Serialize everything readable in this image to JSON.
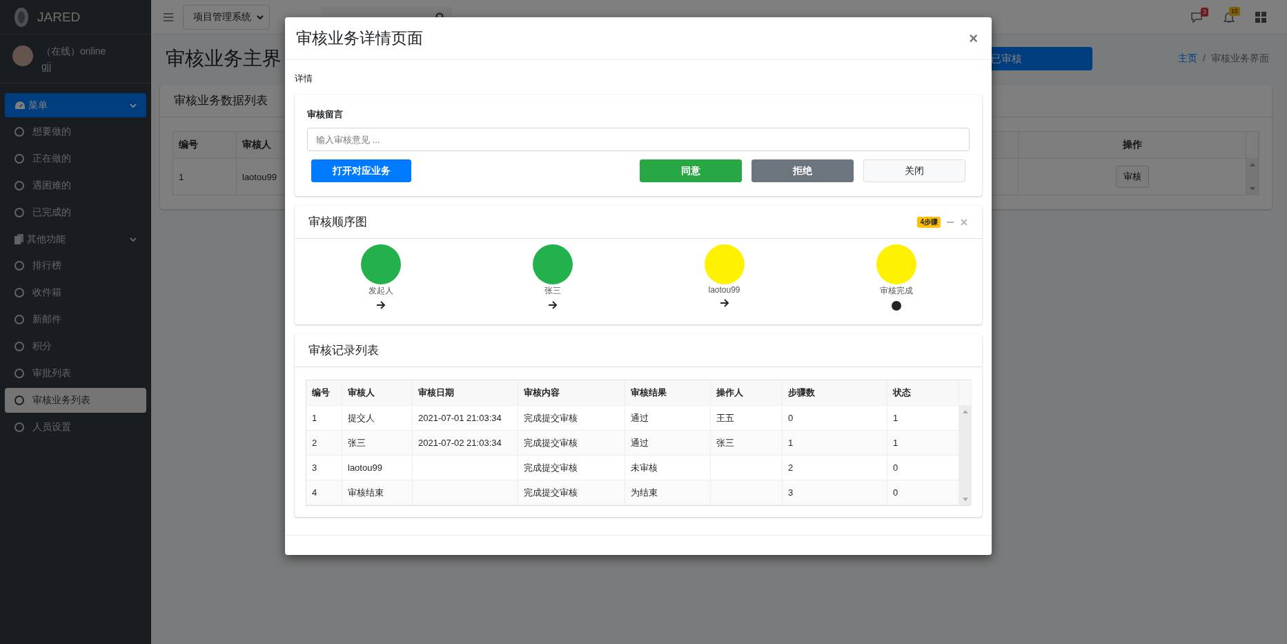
{
  "sidebar": {
    "brand": "JARED",
    "user": {
      "status": "（在线）online",
      "name": "gjj"
    },
    "groups": [
      {
        "label": "菜单",
        "expanded": true,
        "selected": true,
        "items": [
          {
            "label": "想要做的",
            "selected": false
          },
          {
            "label": "正在做的",
            "selected": false
          },
          {
            "label": "遇困难的",
            "selected": false
          },
          {
            "label": "已完成的",
            "selected": false
          }
        ]
      },
      {
        "label": "其他功能",
        "expanded": true,
        "selected": false,
        "items": [
          {
            "label": "排行榜",
            "selected": false
          },
          {
            "label": "收件箱",
            "selected": false
          },
          {
            "label": "新邮件",
            "selected": false
          },
          {
            "label": "积分",
            "selected": false
          },
          {
            "label": "审批列表",
            "selected": false
          },
          {
            "label": "审核业务列表",
            "selected": true
          },
          {
            "label": "人员设置",
            "selected": false
          }
        ]
      }
    ]
  },
  "topbar": {
    "system_select": "项目管理系统",
    "badges": [
      {
        "count": "3",
        "kind": "danger"
      },
      {
        "count": "15",
        "kind": "warning"
      }
    ]
  },
  "page": {
    "title": "审核业务主界",
    "action_button": "已审核",
    "breadcrumb": {
      "items": [
        "主页",
        "审核业务界面"
      ],
      "separator": "/"
    },
    "card": {
      "title": "审核业务数据列表",
      "columns": [
        "编号",
        "审核人",
        "操作"
      ],
      "rows": [
        {
          "cells": [
            "1",
            "laotou99"
          ],
          "action": "审核"
        }
      ]
    }
  },
  "modal": {
    "title": "审核业务详情页面",
    "close": "×",
    "section_label": "详情",
    "comment": {
      "label": "审核留言",
      "placeholder": "输入审核意见 ...",
      "buttons": [
        {
          "label": "打开对应业务",
          "kind": "primary"
        },
        {
          "label": "同意",
          "kind": "success"
        },
        {
          "label": "拒绝",
          "kind": "secondary"
        },
        {
          "label": "关闭",
          "kind": "light"
        }
      ]
    },
    "flow": {
      "title": "审核顺序图",
      "badge": "4步骤",
      "nodes": [
        {
          "label": "发起人",
          "color": "#22b14c",
          "kind": "arrow"
        },
        {
          "label": "张三",
          "color": "#22b14c",
          "kind": "arrow"
        },
        {
          "label": "laotou99",
          "color": "#fff200",
          "kind": "arrow"
        },
        {
          "label": "审核完成",
          "color": "#fff200",
          "kind": "end"
        }
      ]
    },
    "records": {
      "title": "审核记录列表",
      "columns": [
        "编号",
        "审核人",
        "审核日期",
        "审核内容",
        "审核结果",
        "操作人",
        "步骤数",
        "状态"
      ],
      "rows": [
        [
          "1",
          "提交人",
          "2021-07-01 21:03:34",
          "完成提交审核",
          "通过",
          "王五",
          "0",
          "1"
        ],
        [
          "2",
          "张三",
          "2021-07-02 21:03:34",
          "完成提交审核",
          "通过",
          "张三",
          "1",
          "1"
        ],
        [
          "3",
          "laotou99",
          null,
          "完成提交审核",
          "未审核",
          null,
          "2",
          "0"
        ],
        [
          "4",
          "审核结束",
          null,
          "完成提交审核",
          "为结束",
          null,
          "3",
          "0"
        ]
      ]
    }
  }
}
